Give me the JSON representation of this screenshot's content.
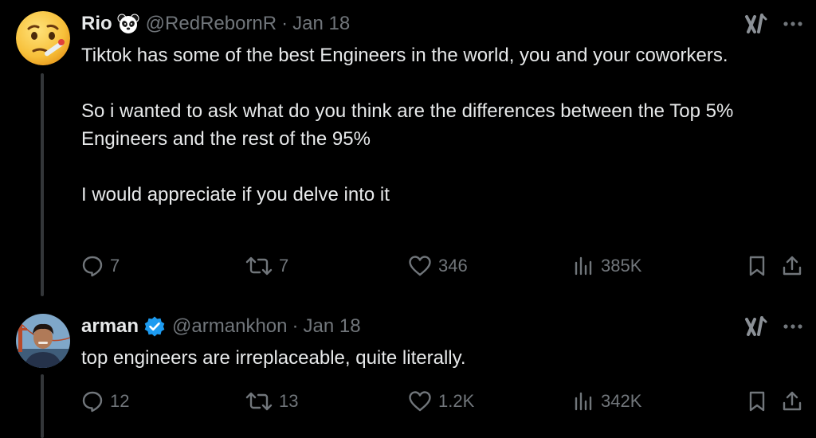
{
  "posts": [
    {
      "name": "Rio",
      "handle": "@RedRebornR",
      "separator": "·",
      "date": "Jan 18",
      "text": "Tiktok has some of the best Engineers in the world, you and your coworkers.\n\nSo i wanted to ask what do you think are the differences between the Top 5% Engineers and the rest of the 95%\n\nI would appreciate if you delve into it",
      "badge_icon": "panda-face-icon",
      "avatar_icon": "thermometer-face-emoji",
      "replies": "7",
      "reposts": "7",
      "likes": "346",
      "views": "385K"
    },
    {
      "name": "arman",
      "handle": "@armankhon",
      "separator": "·",
      "date": "Jan 18",
      "text": "top engineers are irreplaceable, quite literally.",
      "badge_icon": "verified-badge-icon",
      "badge_color": "#1d9bf0",
      "avatar_icon": "profile-photo",
      "replies": "12",
      "reposts": "13",
      "likes": "1.2K",
      "views": "342K"
    }
  ],
  "colors": {
    "background": "#000000",
    "text": "#e7e9ea",
    "muted": "#71767b",
    "thread_line": "#333639"
  }
}
